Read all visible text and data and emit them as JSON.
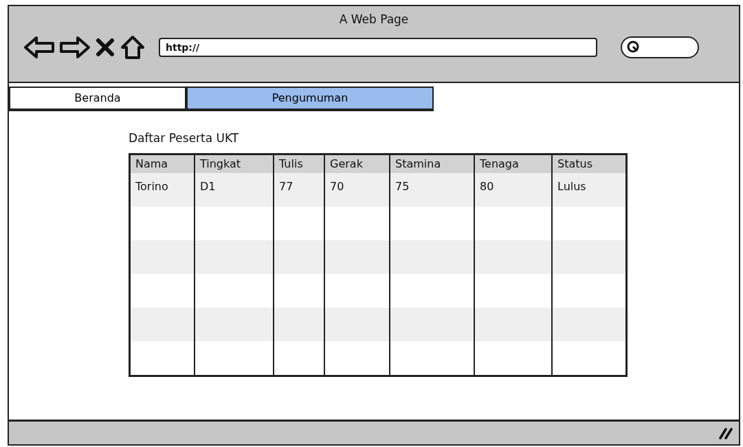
{
  "window": {
    "title": "A Web Page"
  },
  "address_bar": {
    "value": "http://"
  },
  "tabs": [
    {
      "label": "Beranda",
      "selected": false
    },
    {
      "label": "Pengumuman",
      "selected": true
    }
  ],
  "table": {
    "title": "Daftar Peserta UKT",
    "columns": [
      "Nama",
      "Tingkat",
      "Tulis",
      "Gerak",
      "Stamina",
      "Tenaga",
      "Status"
    ],
    "rows": [
      [
        "Torino",
        "D1",
        "77",
        "70",
        "75",
        "80",
        "Lulus"
      ]
    ]
  }
}
